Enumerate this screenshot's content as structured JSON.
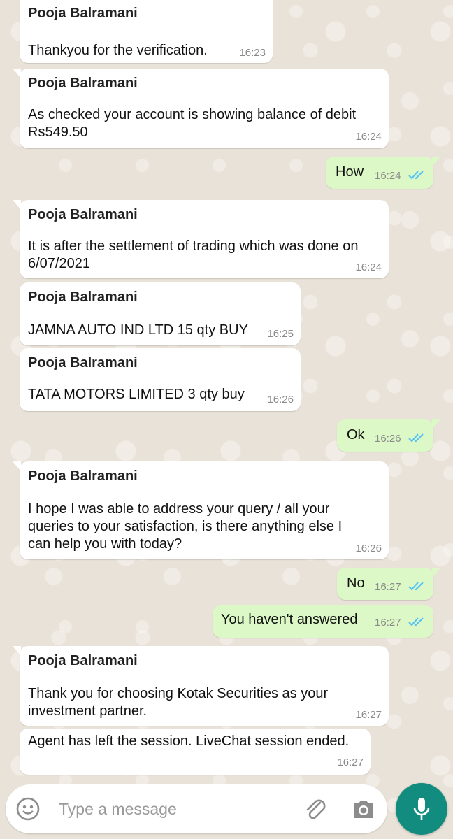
{
  "messages": [
    {
      "type": "in",
      "sender": "Pooja Balramani",
      "text": "Thankyou for the verification.",
      "time": "16:23"
    },
    {
      "type": "in",
      "sender": "Pooja Balramani",
      "text": "As checked your account is showing balance of debit\nRs549.50",
      "time": "16:24"
    },
    {
      "type": "out",
      "text": "How",
      "time": "16:24",
      "status": "read"
    },
    {
      "type": "in",
      "sender": "Pooja Balramani",
      "text": "It is after the settlement of trading which was done on\n6/07/2021",
      "time": "16:24"
    },
    {
      "type": "in",
      "sender": "Pooja Balramani",
      "text": "JAMNA AUTO IND LTD 15 qty BUY",
      "time": "16:25"
    },
    {
      "type": "in",
      "sender": "Pooja Balramani",
      "text": "TATA MOTORS LIMITED  3 qty buy",
      "time": "16:26"
    },
    {
      "type": "out",
      "text": "Ok",
      "time": "16:26",
      "status": "read"
    },
    {
      "type": "in",
      "sender": "Pooja Balramani",
      "text": "I hope I was able to address your query / all your\nqueries to your satisfaction, is there anything else I\ncan help you with today?",
      "time": "16:26"
    },
    {
      "type": "out",
      "text": "No",
      "time": "16:27",
      "status": "read"
    },
    {
      "type": "out",
      "text": "You haven't answered",
      "time": "16:27",
      "status": "read"
    },
    {
      "type": "in",
      "sender": "Pooja Balramani",
      "text": "Thank you for choosing Kotak Securities as your\ninvestment partner.",
      "time": "16:27"
    },
    {
      "type": "in",
      "text": "Agent has left the session. LiveChat session ended.",
      "time": "16:27"
    }
  ],
  "composer": {
    "placeholder": "Type a message",
    "icons": [
      "emoji-icon",
      "attach-icon",
      "camera-icon",
      "mic-icon"
    ]
  },
  "colors": {
    "incoming_bubble": "#ffffff",
    "outgoing_bubble": "#dcf8c6",
    "read_ticks": "#4fc3f7",
    "accent": "#128c7e"
  }
}
